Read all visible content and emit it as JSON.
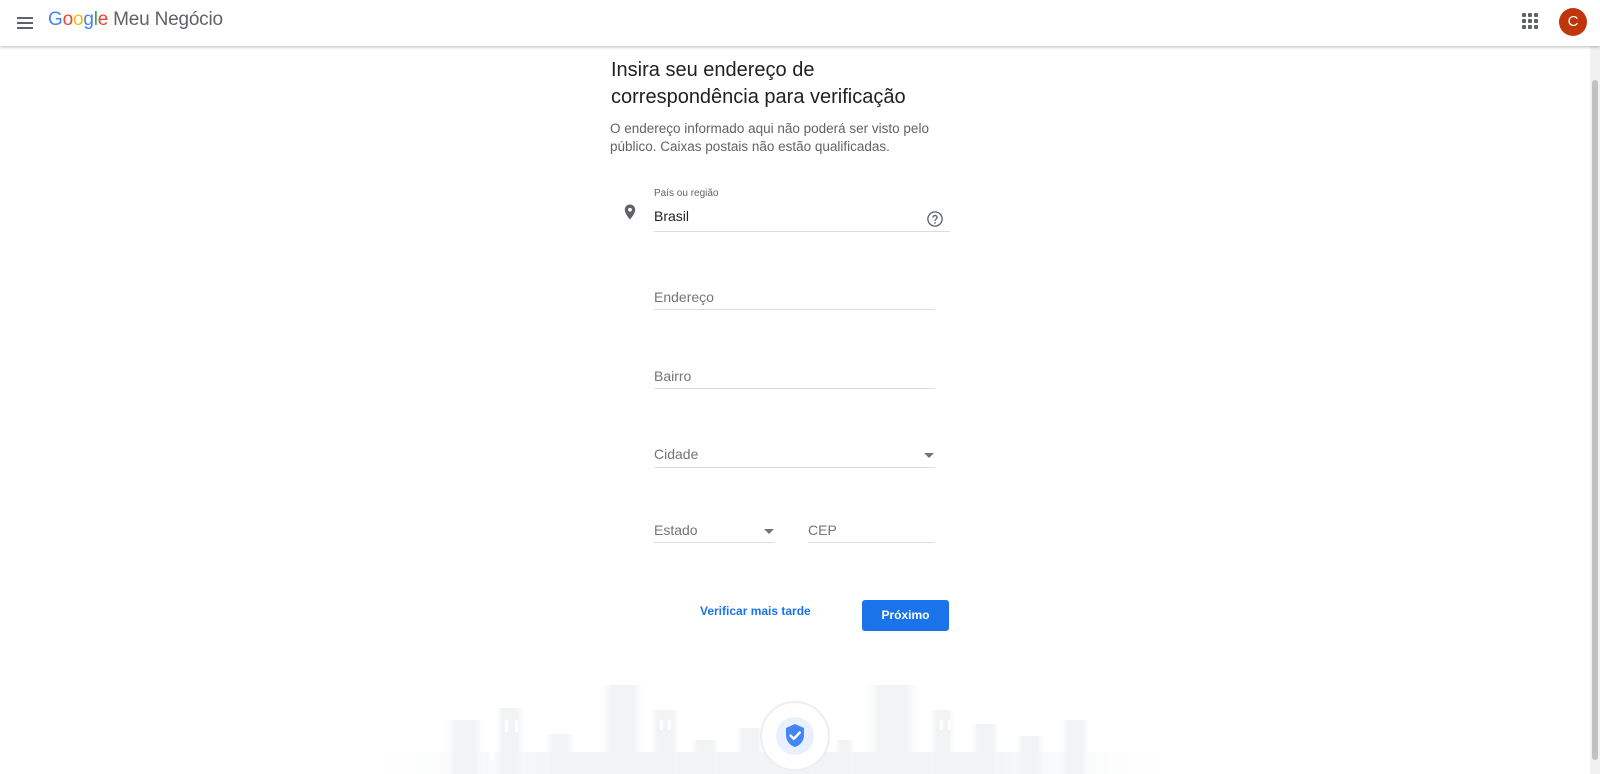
{
  "header": {
    "logo_letters": [
      {
        "char": "G",
        "color": "#4285F4"
      },
      {
        "char": "o",
        "color": "#EA4335"
      },
      {
        "char": "o",
        "color": "#FBBC05"
      },
      {
        "char": "g",
        "color": "#4285F4"
      },
      {
        "char": "l",
        "color": "#34A853"
      },
      {
        "char": "e",
        "color": "#EA4335"
      }
    ],
    "product_name": "Meu Negócio",
    "avatar_letter": "C",
    "avatar_color": "#bf360c",
    "menu_icon": "hamburger-menu-icon",
    "apps_icon": "apps-grid-icon"
  },
  "page": {
    "title_line1": "Insira seu endereço de",
    "title_line2": "correspondência para verificação",
    "subtitle_line1": "O endereço informado aqui não poderá ser visto pelo",
    "subtitle_line2": "público. Caixas postais não estão qualificadas."
  },
  "form": {
    "country": {
      "label": "País ou região",
      "value": "Brasil",
      "icon": "location-pin-icon",
      "help_icon": "help-circle-icon"
    },
    "address": {
      "placeholder": "Endereço"
    },
    "neighborhood": {
      "placeholder": "Bairro"
    },
    "city": {
      "placeholder": "Cidade"
    },
    "state": {
      "placeholder": "Estado"
    },
    "zip": {
      "placeholder": "CEP"
    }
  },
  "actions": {
    "later_label": "Verificar mais tarde",
    "next_label": "Próximo"
  },
  "colors": {
    "accent": "#1a73e8",
    "shield": "#4285F4"
  },
  "illustration": {
    "icon": "verified-shield-icon"
  }
}
